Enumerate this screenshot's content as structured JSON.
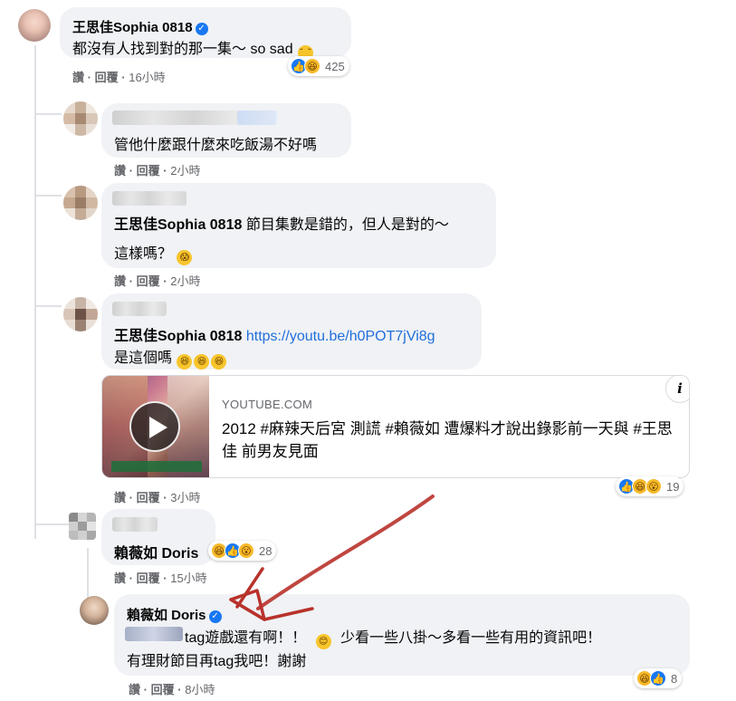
{
  "comments": {
    "c1": {
      "author": "王思佳Sophia 0818",
      "text": "都沒有人找到對的那一集～ so sad",
      "like_label": "讚",
      "reply_label": "回覆",
      "time": "16小時",
      "reaction_count": "425"
    },
    "c2": {
      "text": "管他什麼跟什麼來吃飯湯不好嗎",
      "like_label": "讚",
      "reply_label": "回覆",
      "time": "2小時"
    },
    "c3": {
      "mention": "王思佳Sophia 0818",
      "text": "節目集數是錯的，但人是對的～",
      "text2": "這樣嗎？",
      "like_label": "讚",
      "reply_label": "回覆",
      "time": "2小時"
    },
    "c4": {
      "mention": "王思佳Sophia 0818",
      "link": "https://youtu.be/h0POT7jVi8g",
      "text2": "是這個嗎",
      "card_source": "YOUTUBE.COM",
      "card_title": "2012 #麻辣天后宮 測謊 #賴薇如 遭爆料才說出錄影前一天與 #王思佳 前男友見面",
      "card_info_icon": "i",
      "like_label": "讚",
      "reply_label": "回覆",
      "time": "3小時",
      "reaction_count": "19"
    },
    "c5": {
      "mention": "賴薇如 Doris",
      "like_label": "讚",
      "reply_label": "回覆",
      "time": "15小時",
      "reaction_count": "28"
    },
    "c6": {
      "author": "賴薇如 Doris",
      "text_a": "tag遊戲還有啊！！",
      "text_b": "少看一些八掛～多看一些有用的資訊吧！",
      "text2": "有理財節目再tag我吧！謝謝",
      "like_label": "讚",
      "reply_label": "回覆",
      "time": "8小時",
      "reaction_count": "8"
    }
  },
  "separator": "·",
  "colors": {
    "bubble": "#f0f2f5",
    "link": "#216fdb",
    "meta": "#65676b",
    "arrow": "#c0392b",
    "verified": "#1877f2"
  }
}
